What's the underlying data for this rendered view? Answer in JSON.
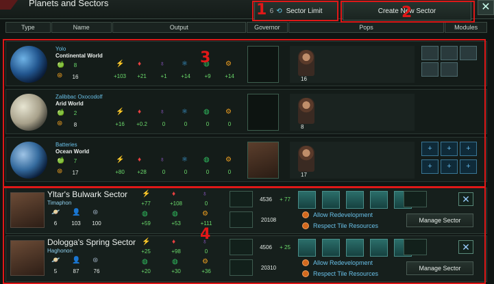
{
  "window": {
    "title": "Planets and Sectors",
    "close": "✕"
  },
  "header": {
    "sector_limit_count": "6",
    "sector_limit_label": "Sector Limit",
    "create_sector_label": "Create New Sector"
  },
  "columns": [
    "Type",
    "Name",
    "Output",
    "Governor",
    "Pops",
    "Modules"
  ],
  "icons": {
    "food": "🍏",
    "energy": "⚡",
    "minerals": "♦",
    "influence": "♁",
    "physics": "⚛",
    "society": "◍",
    "engineering": "⚙",
    "stability": "⊛",
    "pops": "👤",
    "planets": "🪐"
  },
  "planets": [
    {
      "name": "Yolo",
      "type": "Continental World",
      "food": "8",
      "stability": "16",
      "outputs": [
        "+103",
        "+21",
        "+1",
        "+14",
        "+9",
        "+14"
      ],
      "pops": "16"
    },
    {
      "name": "Zalibbac Oxocodolf",
      "type": "Arid World",
      "food": "2",
      "stability": "8",
      "outputs": [
        "+16",
        "+0.2",
        "0",
        "0",
        "0",
        "0"
      ],
      "pops": "8"
    },
    {
      "name": "Batteries",
      "type": "Ocean World",
      "food": "7",
      "stability": "17",
      "outputs": [
        "+80",
        "+28",
        "0",
        "0",
        "0",
        "0"
      ],
      "pops": "17"
    }
  ],
  "sectors": [
    {
      "name": "Yltar's Bulwark Sector",
      "capital": "Timaphon",
      "planets": "6",
      "pops": "103",
      "stability": "100",
      "outputs": [
        "+77",
        "+108",
        "0",
        "+59",
        "+53",
        "+111"
      ],
      "energy_stock": "4536",
      "energy_delta": "+ 77",
      "mineral_stock": "20108",
      "allow_redevelopment": "Allow Redevelopment",
      "respect_tiles": "Respect Tile Resources",
      "manage_label": "Manage Sector"
    },
    {
      "name": "Dologga's Spring Sector",
      "capital": "Haghonon",
      "planets": "5",
      "pops": "87",
      "stability": "76",
      "outputs": [
        "+25",
        "+98",
        "0",
        "+20",
        "+30",
        "+36"
      ],
      "energy_stock": "4506",
      "energy_delta": "+ 25",
      "mineral_stock": "20310",
      "allow_redevelopment": "Allow Redevelopment",
      "respect_tiles": "Respect Tile Resources",
      "manage_label": "Manage Sector"
    }
  ],
  "annotations": [
    "1",
    "2",
    "3",
    "4"
  ],
  "colors": {
    "accent_green": "#6cdc6c",
    "accent_blue": "#69c0e8",
    "annotation_red": "#e01818",
    "energy": "#f0d020",
    "minerals": "#e84040",
    "influence": "#a060e0"
  }
}
